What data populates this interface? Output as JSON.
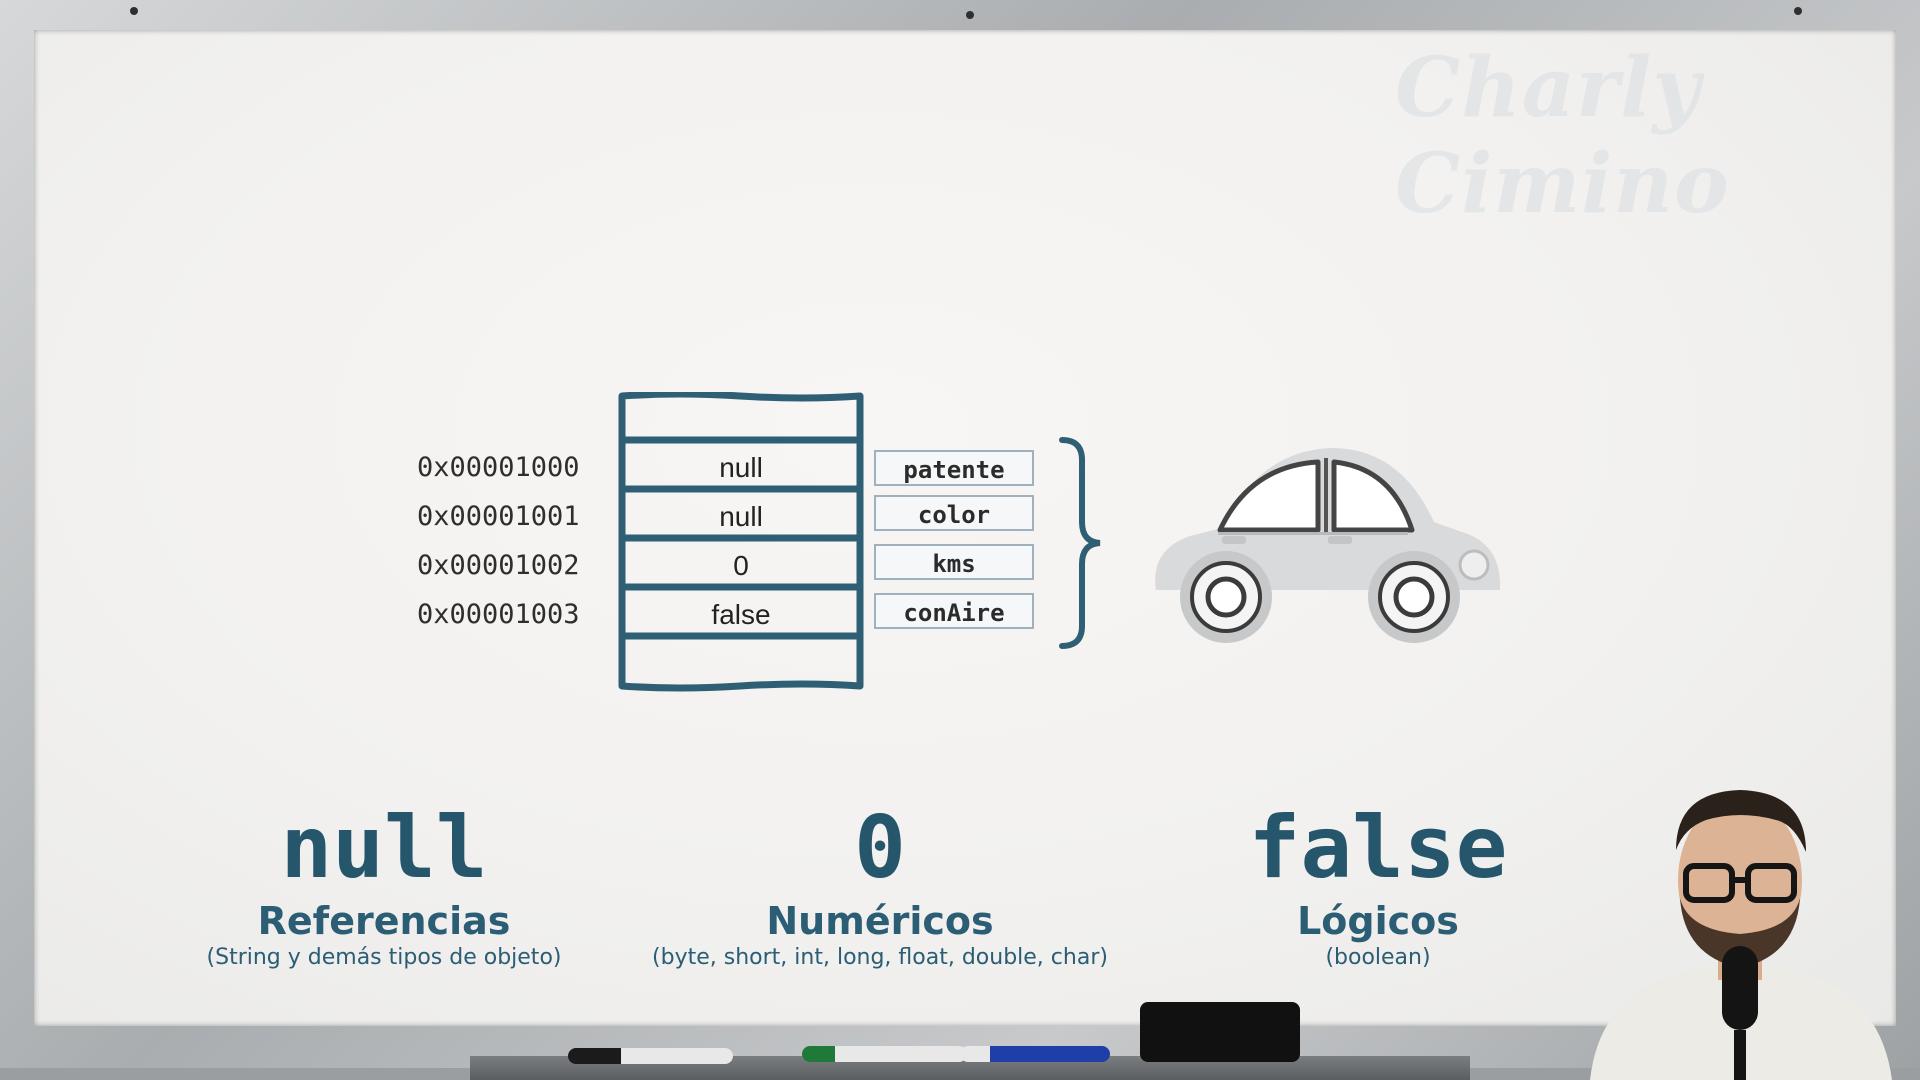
{
  "watermark": "Charly Cimino",
  "memory": {
    "addresses": [
      "0x00001000",
      "0x00001001",
      "0x00001002",
      "0x00001003"
    ],
    "values": [
      "null",
      "null",
      "0",
      "false"
    ],
    "fields": [
      "patente",
      "color",
      "kms",
      "conAire"
    ]
  },
  "defaults": [
    {
      "value": "null",
      "category": "Referencias",
      "examples": "(String y demás tipos de objeto)"
    },
    {
      "value": "0",
      "category": "Numéricos",
      "examples": "(byte, short, int, long, float, double, char)"
    },
    {
      "value": "false",
      "category": "Lógicos",
      "examples": "(boolean)"
    }
  ],
  "colors": {
    "accent": "#26566c",
    "memory_border": "#2f5f74",
    "field_border": "#9fb1bd"
  },
  "icons": [
    "car-icon",
    "curly-brace-icon",
    "presenter-image"
  ]
}
